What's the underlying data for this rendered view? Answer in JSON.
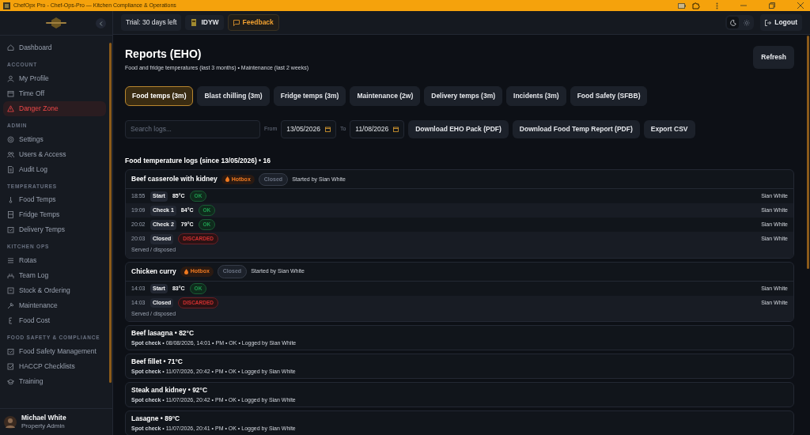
{
  "window": {
    "title": "ChefOpx Pro - Chef-Ops-Pro — Kitchen Compliance & Operations"
  },
  "sidebar": {
    "groups": [
      {
        "items": [
          {
            "label": "Dashboard",
            "selected": false,
            "danger": false
          }
        ]
      },
      {
        "heading": "ACCOUNT",
        "items": [
          {
            "label": "My Profile",
            "selected": false,
            "danger": false
          },
          {
            "label": "Time Off",
            "selected": false,
            "danger": false
          },
          {
            "label": "Danger Zone",
            "selected": true,
            "danger": true
          }
        ]
      },
      {
        "heading": "ADMIN",
        "items": [
          {
            "label": "Settings",
            "selected": false,
            "danger": false
          },
          {
            "label": "Users & Access",
            "selected": false,
            "danger": false
          },
          {
            "label": "Audit Log",
            "selected": false,
            "danger": false
          }
        ]
      },
      {
        "heading": "TEMPERATURES",
        "items": [
          {
            "label": "Food Temps",
            "selected": false,
            "danger": false
          },
          {
            "label": "Fridge Temps",
            "selected": false,
            "danger": false
          },
          {
            "label": "Delivery Temps",
            "selected": false,
            "danger": false
          }
        ]
      },
      {
        "heading": "KITCHEN OPS",
        "items": [
          {
            "label": "Rotas",
            "selected": false,
            "danger": false
          },
          {
            "label": "Team Log",
            "selected": false,
            "danger": false
          },
          {
            "label": "Stock & Ordering",
            "selected": false,
            "danger": false
          },
          {
            "label": "Maintenance",
            "selected": false,
            "danger": false
          },
          {
            "label": "Food Cost",
            "selected": false,
            "danger": false
          }
        ]
      },
      {
        "heading": "FOOD SAFETY & COMPLIANCE",
        "items": [
          {
            "label": "Food Safety Management",
            "selected": false,
            "danger": false
          },
          {
            "label": "HACCP Checklists",
            "selected": false,
            "danger": false
          },
          {
            "label": "Training",
            "selected": false,
            "danger": false
          }
        ]
      }
    ],
    "user": {
      "name": "Michael White",
      "role": "Property Admin"
    }
  },
  "header": {
    "trial": "Trial: 30 days left",
    "site": "IDYW",
    "feedback": "Feedback",
    "theme": [
      {
        "kind": "dark",
        "selected": true
      },
      {
        "kind": "light",
        "selected": false
      }
    ],
    "logout": "Logout"
  },
  "page": {
    "title": "Reports (EHO)",
    "subtitle": "Food and fridge temperatures (last 3 months) • Maintenance (last 2 weeks)",
    "refresh": "Refresh"
  },
  "tabs": [
    {
      "label": "Food temps (3m)",
      "selected": true
    },
    {
      "label": "Blast chilling (3m)",
      "selected": false
    },
    {
      "label": "Fridge temps (3m)",
      "selected": false
    },
    {
      "label": "Maintenance (2w)",
      "selected": false
    },
    {
      "label": "Delivery temps (3m)",
      "selected": false
    },
    {
      "label": "Incidents (3m)",
      "selected": false
    },
    {
      "label": "Food Safety (SFBB)",
      "selected": false
    }
  ],
  "filters": {
    "search": {
      "placeholder": "Search logs..."
    },
    "from_label": "From",
    "from": "13/05/2026",
    "to_label": "To",
    "to": "11/08/2026",
    "buttons": [
      "Download EHO Pack (PDF)",
      "Download Food Temp Report (PDF)",
      "Export CSV"
    ]
  },
  "logs": {
    "heading": "Food temperature logs (since 13/05/2026) • 16",
    "entries": [
      {
        "kind": "session",
        "name": "Beef casserole with kidney",
        "tag": "Hotbox",
        "status": "Closed",
        "started_by": "Started by Sian White",
        "note": "Served / disposed",
        "rows": [
          {
            "time": "18:55",
            "step": "Start",
            "temp": "85°C",
            "result": "OK",
            "ok": true,
            "user": "Sian White"
          },
          {
            "time": "19:09",
            "step": "Check 1",
            "temp": "84°C",
            "result": "OK",
            "ok": true,
            "user": "Sian White"
          },
          {
            "time": "20:02",
            "step": "Check 2",
            "temp": "79°C",
            "result": "OK",
            "ok": true,
            "user": "Sian White"
          },
          {
            "time": "20:03",
            "step": "Closed",
            "result": "DISCARDED",
            "ok": false,
            "user": "Sian White"
          }
        ]
      },
      {
        "kind": "session",
        "name": "Chicken curry",
        "tag": "Hotbox",
        "status": "Closed",
        "started_by": "Started by Sian White",
        "note": "Served / disposed",
        "rows": [
          {
            "time": "14:03",
            "step": "Start",
            "temp": "83°C",
            "result": "OK",
            "ok": true,
            "user": "Sian White"
          },
          {
            "time": "14:03",
            "step": "Closed",
            "result": "DISCARDED",
            "ok": false,
            "user": "Sian White"
          }
        ]
      },
      {
        "kind": "spot",
        "title": "Beef lasagna • 82°C",
        "meta": "**Spot check** • 08/08/2026, 14:01 • PM • OK • Logged by Sian White"
      },
      {
        "kind": "spot",
        "title": "Beef fillet • 71°C",
        "meta": "**Spot check** • 11/07/2026, 20:42 • PM • OK • Logged by Sian White"
      },
      {
        "kind": "spot",
        "title": "Steak and kidney • 92°C",
        "meta": "**Spot check** • 11/07/2026, 20:42 • PM • OK • Logged by Sian White"
      },
      {
        "kind": "spot",
        "title": "Lasagne • 89°C",
        "meta": "**Spot check** • 11/07/2026, 20:41 • PM • OK • Logged by Sian White"
      }
    ]
  }
}
